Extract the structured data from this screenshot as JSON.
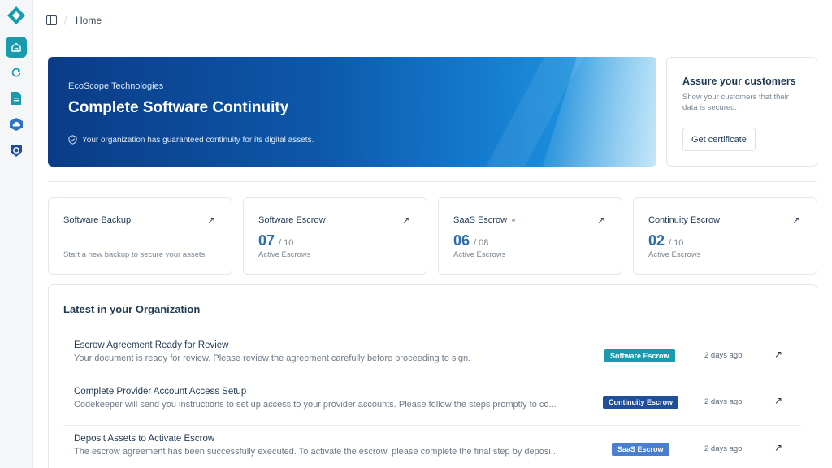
{
  "breadcrumb": {
    "home": "Home"
  },
  "hero": {
    "org": "EcoScope Technologies",
    "title": "Complete Software Continuity",
    "note": "Your organization has guaranteed continuity for its digital assets."
  },
  "assure": {
    "title": "Assure your customers",
    "text": "Show your customers that their data is secured.",
    "button": "Get certificate"
  },
  "cards": [
    {
      "name": "Software Backup",
      "desc": "Start a new backup to secure your assets."
    },
    {
      "name": "Software Escrow",
      "value": "07",
      "total": "/ 10",
      "sub": "Active Escrows"
    },
    {
      "name": "SaaS Escrow",
      "value": "06",
      "total": "/ 08",
      "sub": "Active Escrows"
    },
    {
      "name": "Continuity Escrow",
      "value": "02",
      "total": "/ 10",
      "sub": "Active Escrows"
    }
  ],
  "latest": {
    "title": "Latest in your Organization",
    "items": [
      {
        "title": "Escrow Agreement Ready for Review",
        "desc": "Your document is ready for review. Please review the agreement carefully before proceeding to sign.",
        "badge": "Software Escrow",
        "badge_color": "#1a9aad",
        "when": "2 days ago"
      },
      {
        "title": "Complete Provider Account Access Setup",
        "desc": "Codekeeper will send you instructions to set up access to your provider accounts. Please follow the steps promptly to co...",
        "badge": "Continuity Escrow",
        "badge_color": "#1f4f99",
        "when": "2 days ago"
      },
      {
        "title": "Deposit Assets to Activate Escrow",
        "desc": "The escrow agreement has been successfully executed. To activate the escrow, please complete the final step by deposi...",
        "badge": "SaaS Escrow",
        "badge_color": "#4a7fcf",
        "when": "2 days ago"
      }
    ]
  },
  "icons": {
    "arrow": "↗"
  }
}
